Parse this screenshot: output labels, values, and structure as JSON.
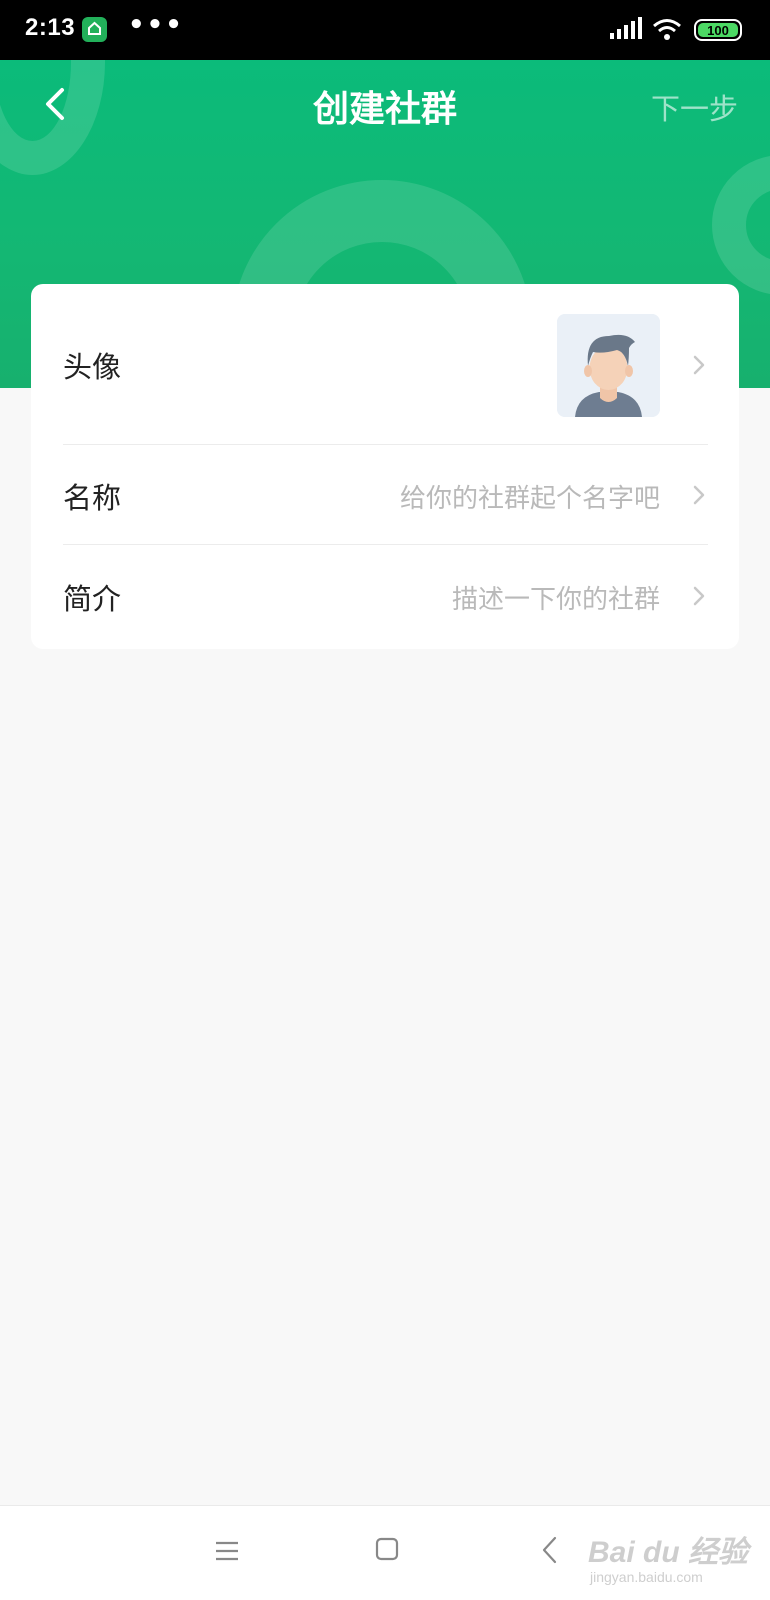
{
  "status_bar": {
    "time": "2:13",
    "more": "•••",
    "battery": "100",
    "battery_level_percent": 100
  },
  "header": {
    "title": "创建社群",
    "next_label": "下一步",
    "accent_color": "#12b673"
  },
  "form": {
    "rows": [
      {
        "label": "头像",
        "value": ""
      },
      {
        "label": "名称",
        "placeholder": "给你的社群起个名字吧"
      },
      {
        "label": "简介",
        "placeholder": "描述一下你的社群"
      }
    ]
  },
  "watermark": {
    "logo": "Bai du 经验",
    "url": "jingyan.baidu.com"
  }
}
